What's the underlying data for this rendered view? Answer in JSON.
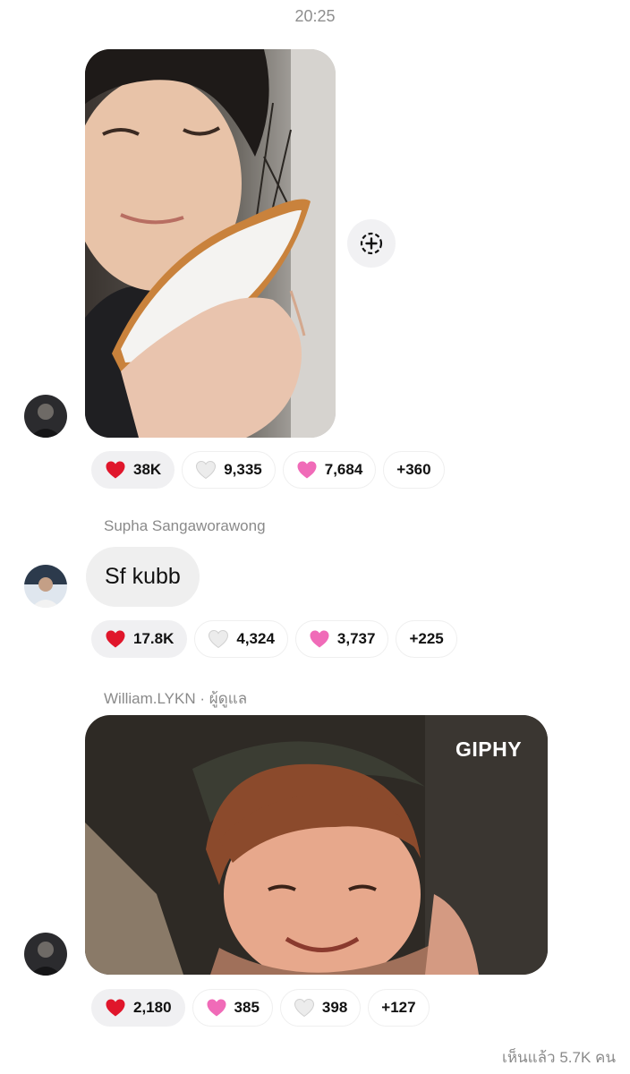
{
  "timestamp": "20:25",
  "messages": [
    {
      "type": "photo",
      "reactions": [
        {
          "emoji": "red-heart",
          "count": "38K",
          "active": true
        },
        {
          "emoji": "white-heart",
          "count": "9,335"
        },
        {
          "emoji": "pink-heart",
          "count": "7,684"
        }
      ],
      "more": "+360"
    },
    {
      "type": "text",
      "sender": "Supha Sangaworawong",
      "text": "Sf kubb",
      "reactions": [
        {
          "emoji": "red-heart",
          "count": "17.8K",
          "active": true
        },
        {
          "emoji": "white-heart",
          "count": "4,324"
        },
        {
          "emoji": "pink-heart",
          "count": "3,737"
        }
      ],
      "more": "+225"
    },
    {
      "type": "gif",
      "sender": "William.LYKN",
      "sender_role": " · ผู้ดูแล",
      "gif_brand": "GIPHY",
      "reactions": [
        {
          "emoji": "red-heart",
          "count": "2,180",
          "active": true
        },
        {
          "emoji": "pink-heart",
          "count": "385"
        },
        {
          "emoji": "white-heart",
          "count": "398"
        }
      ],
      "more": "+127"
    }
  ],
  "seen": "เห็นแล้ว 5.7K คน",
  "colors": {
    "red_heart": "#e0162b",
    "pink_heart": "#f06bb8",
    "white_heart": "#ececec",
    "bubble": "#efefef"
  }
}
